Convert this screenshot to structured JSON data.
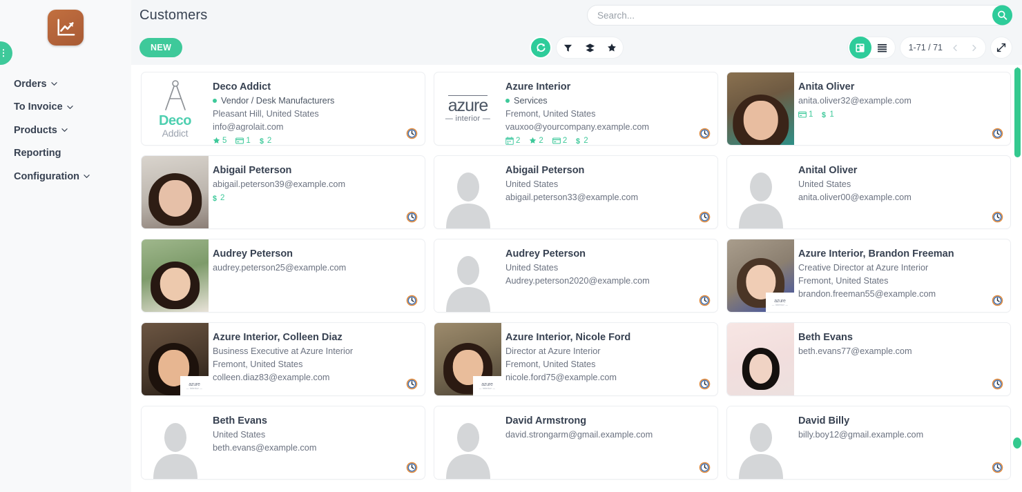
{
  "app": {
    "logo_icon": "chart-growth-icon",
    "accent": "#3ec99a",
    "brand_brown": "#b3633a"
  },
  "sidebar": {
    "items": [
      {
        "label": "Orders",
        "has_caret": true
      },
      {
        "label": "To Invoice",
        "has_caret": true
      },
      {
        "label": "Products",
        "has_caret": true
      },
      {
        "label": "Reporting",
        "has_caret": false
      },
      {
        "label": "Configuration",
        "has_caret": true
      }
    ]
  },
  "header": {
    "title": "Customers",
    "search_placeholder": "Search...",
    "search_value": "",
    "search_icon": "search-icon"
  },
  "controls": {
    "new_label": "NEW",
    "reload_icon": "reload-icon",
    "filter_icon": "filter-icon",
    "groupby_icon": "layers-icon",
    "favorites_icon": "star-icon",
    "kanban_icon": "kanban-view-icon",
    "list_icon": "list-view-icon",
    "pager_text": "1-71 / 71",
    "prev_icon": "chevron-left-icon",
    "next_icon": "chevron-right-icon",
    "expand_icon": "expand-icon"
  },
  "cards": [
    {
      "name": "Deco Addict",
      "tag": "Vendor / Desk Manufacturers",
      "location": "Pleasant Hill, United States",
      "email": "info@agrolait.com",
      "avatar": "logo-deco",
      "logo_line1": "Deco",
      "logo_line2": "Addict",
      "stats": [
        {
          "icon": "star-icon",
          "value": "5"
        },
        {
          "icon": "card-icon",
          "value": "1"
        },
        {
          "icon": "dollar-icon",
          "value": "2"
        }
      ]
    },
    {
      "name": "Azure Interior",
      "tag": "Services",
      "location": "Fremont, United States",
      "email": "vauxoo@yourcompany.example.com",
      "avatar": "logo-azure",
      "logo_line1": "azure",
      "logo_line2": "— interior —",
      "stats": [
        {
          "icon": "calendar-icon",
          "value": "2"
        },
        {
          "icon": "star-icon",
          "value": "2"
        },
        {
          "icon": "card-icon",
          "value": "2"
        },
        {
          "icon": "dollar-icon",
          "value": "2"
        }
      ]
    },
    {
      "name": "Anita Oliver",
      "tag": "",
      "location": "",
      "email": "anita.oliver32@example.com",
      "avatar": "photo-anita",
      "stats": [
        {
          "icon": "card-icon",
          "value": "1"
        },
        {
          "icon": "dollar-icon",
          "value": "1"
        }
      ]
    },
    {
      "name": "Abigail Peterson",
      "tag": "",
      "location": "",
      "email": "abigail.peterson39@example.com",
      "avatar": "photo-abigail",
      "stats": [
        {
          "icon": "dollar-icon",
          "value": "2"
        }
      ]
    },
    {
      "name": "Abigail Peterson",
      "tag": "",
      "location": "United States",
      "email": "abigail.peterson33@example.com",
      "avatar": "placeholder",
      "stats": []
    },
    {
      "name": "Anital Oliver",
      "tag": "",
      "location": "United States",
      "email": "anita.oliver00@example.com",
      "avatar": "placeholder",
      "stats": []
    },
    {
      "name": "Audrey Peterson",
      "tag": "",
      "location": "",
      "email": "audrey.peterson25@example.com",
      "avatar": "photo-audrey",
      "stats": []
    },
    {
      "name": "Audrey Peterson",
      "tag": "",
      "location": "United States",
      "email": "Audrey.peterson2020@example.com",
      "avatar": "placeholder",
      "stats": []
    },
    {
      "name": "Azure Interior, Brandon Freeman",
      "tag": "",
      "job": "Creative Director at Azure Interior",
      "location": "Fremont, United States",
      "email": "brandon.freeman55@example.com",
      "avatar": "photo-brandon",
      "company_badge": "azure",
      "stats": []
    },
    {
      "name": "Azure Interior, Colleen Diaz",
      "tag": "",
      "job": "Business Executive at Azure Interior",
      "location": "Fremont, United States",
      "email": "colleen.diaz83@example.com",
      "avatar": "photo-colleen",
      "company_badge": "azure",
      "stats": []
    },
    {
      "name": "Azure Interior, Nicole Ford",
      "tag": "",
      "job": "Director at Azure Interior",
      "location": "Fremont, United States",
      "email": "nicole.ford75@example.com",
      "avatar": "photo-nicole",
      "company_badge": "azure",
      "stats": []
    },
    {
      "name": "Beth Evans",
      "tag": "",
      "location": "",
      "email": "beth.evans77@example.com",
      "avatar": "photo-beth",
      "stats": []
    },
    {
      "name": "Beth Evans",
      "tag": "",
      "location": "United States",
      "email": "beth.evans@example.com",
      "avatar": "placeholder",
      "stats": []
    },
    {
      "name": "David Armstrong",
      "tag": "",
      "location": "",
      "email": "david.strongarm@gmail.example.com",
      "avatar": "placeholder",
      "stats": []
    },
    {
      "name": "David Billy",
      "tag": "",
      "location": "",
      "email": "billy.boy12@gmail.example.com",
      "avatar": "placeholder",
      "stats": []
    }
  ],
  "badge_text": {
    "line1": "azure",
    "line2": "— interior —"
  }
}
